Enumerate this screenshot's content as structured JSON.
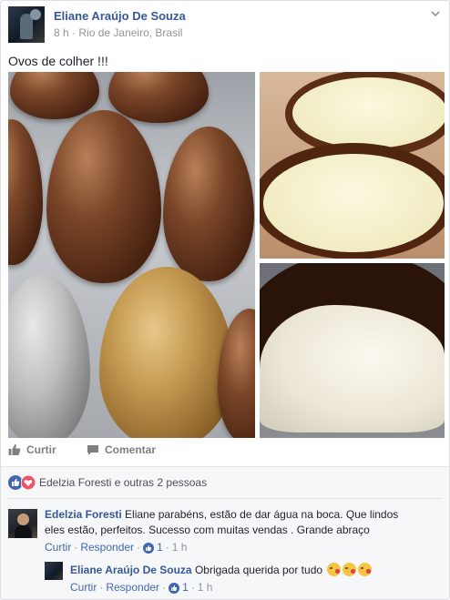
{
  "post": {
    "author": "Eliane Araújo De Souza",
    "time": "8 h",
    "separator": "·",
    "location": "Rio de Janeiro, Brasil",
    "text": "Ovos de colher !!!"
  },
  "actions": {
    "like": "Curtir",
    "comment": "Comentar"
  },
  "reactions": {
    "summary": "Edelzia Foresti e outras 2 pessoas"
  },
  "comments": [
    {
      "author": "Edelzia Foresti",
      "text": "Eliane parabéns, estão de dar água na boca. Que lindos eles estão, perfeitos. Sucesso com muitas vendas . Grande abraço",
      "like": "Curtir",
      "reply": "Responder",
      "like_count": "1",
      "time": "1 h"
    },
    {
      "author": "Eliane Araújo De Souza",
      "text": "Obrigada querida por tudo",
      "like": "Curtir",
      "reply": "Responder",
      "like_count": "1",
      "time": "1 h"
    }
  ],
  "colors": {
    "link": "#365899",
    "meta": "#90949c",
    "like_blue": "#4267b2",
    "heart_red": "#f25268"
  }
}
